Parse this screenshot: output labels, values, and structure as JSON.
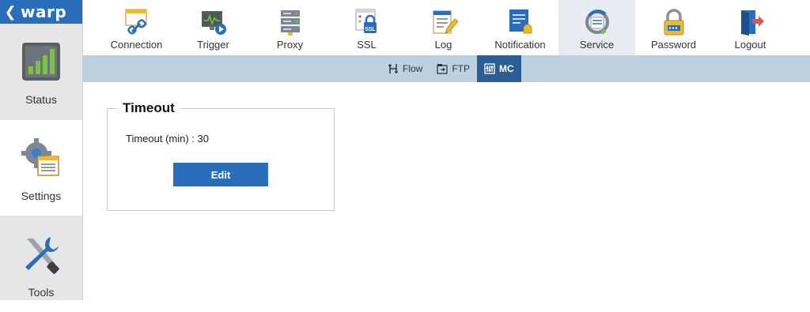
{
  "brand": {
    "back_glyph": "❮",
    "name": "warp",
    "color": "#2a6ebb"
  },
  "sidebar": {
    "items": [
      {
        "label": "Status",
        "icon": "chart-icon"
      },
      {
        "label": "Settings",
        "icon": "gear-document-icon",
        "active": true
      },
      {
        "label": "Tools",
        "icon": "wrench-screwdriver-icon"
      }
    ]
  },
  "toolbar": {
    "items": [
      {
        "label": "Connection",
        "icon": "chain-link-icon"
      },
      {
        "label": "Trigger",
        "icon": "monitor-play-icon"
      },
      {
        "label": "Proxy",
        "icon": "server-icon"
      },
      {
        "label": "SSL",
        "icon": "ssl-lock-icon"
      },
      {
        "label": "Log",
        "icon": "notepad-pencil-icon"
      },
      {
        "label": "Notification",
        "icon": "document-bell-icon"
      },
      {
        "label": "Service",
        "icon": "service-cycle-icon",
        "active": true
      },
      {
        "label": "Password",
        "icon": "padlock-icon"
      },
      {
        "label": "Logout",
        "icon": "door-exit-icon"
      }
    ]
  },
  "subnav": {
    "tabs": [
      {
        "label": "Flow",
        "icon": "flow-icon"
      },
      {
        "label": "FTP",
        "icon": "ftp-icon"
      },
      {
        "label": "MC",
        "icon": "mc-sliders-icon",
        "active": true
      }
    ]
  },
  "panel": {
    "legend": "Timeout",
    "key": "Timeout (min) :",
    "value": "30",
    "edit_label": "Edit"
  },
  "colors": {
    "accent": "#2a6ebb",
    "subnav_bg": "#bdd0e0",
    "subtab_active": "#2b5f93",
    "sidebar_bg": "#e6e6e6"
  }
}
